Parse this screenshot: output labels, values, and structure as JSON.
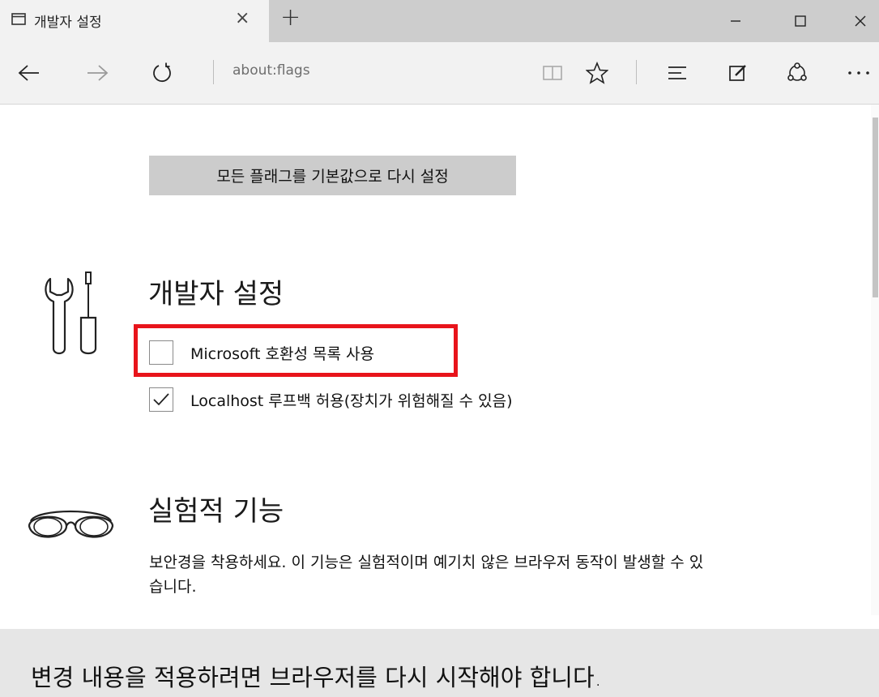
{
  "tab": {
    "title": "개발자 설정",
    "close_glyph": "×",
    "new_tab_glyph": "+"
  },
  "window": {
    "minimize": "—",
    "close": "✕"
  },
  "nav": {
    "address": "about:flags"
  },
  "page": {
    "reset_button": "모든 플래그를 기본값으로 다시 설정",
    "developer_section": {
      "title": "개발자 설정",
      "icon": "wrench-screwdriver-icon",
      "options": [
        {
          "label": "Microsoft 호환성 목록 사용",
          "checked": false,
          "highlighted": true
        },
        {
          "label": "Localhost 루프백 허용(장치가 위험해질 수 있음)",
          "checked": true,
          "highlighted": false
        }
      ]
    },
    "experimental_section": {
      "title": "실험적 기능",
      "icon": "goggles-icon",
      "description": "보안경을 착용하세요. 이 기능은 실험적이며 예기치 않은 브라우저 동작이 발생할 수 있습니다."
    },
    "restart_notice": "변경 내용을 적용하려면 브라우저를 다시 시작해야 합니다."
  },
  "colors": {
    "highlight": "#e8141b",
    "button_bg": "#cccccc",
    "notify_bg": "#e6e6e6"
  }
}
